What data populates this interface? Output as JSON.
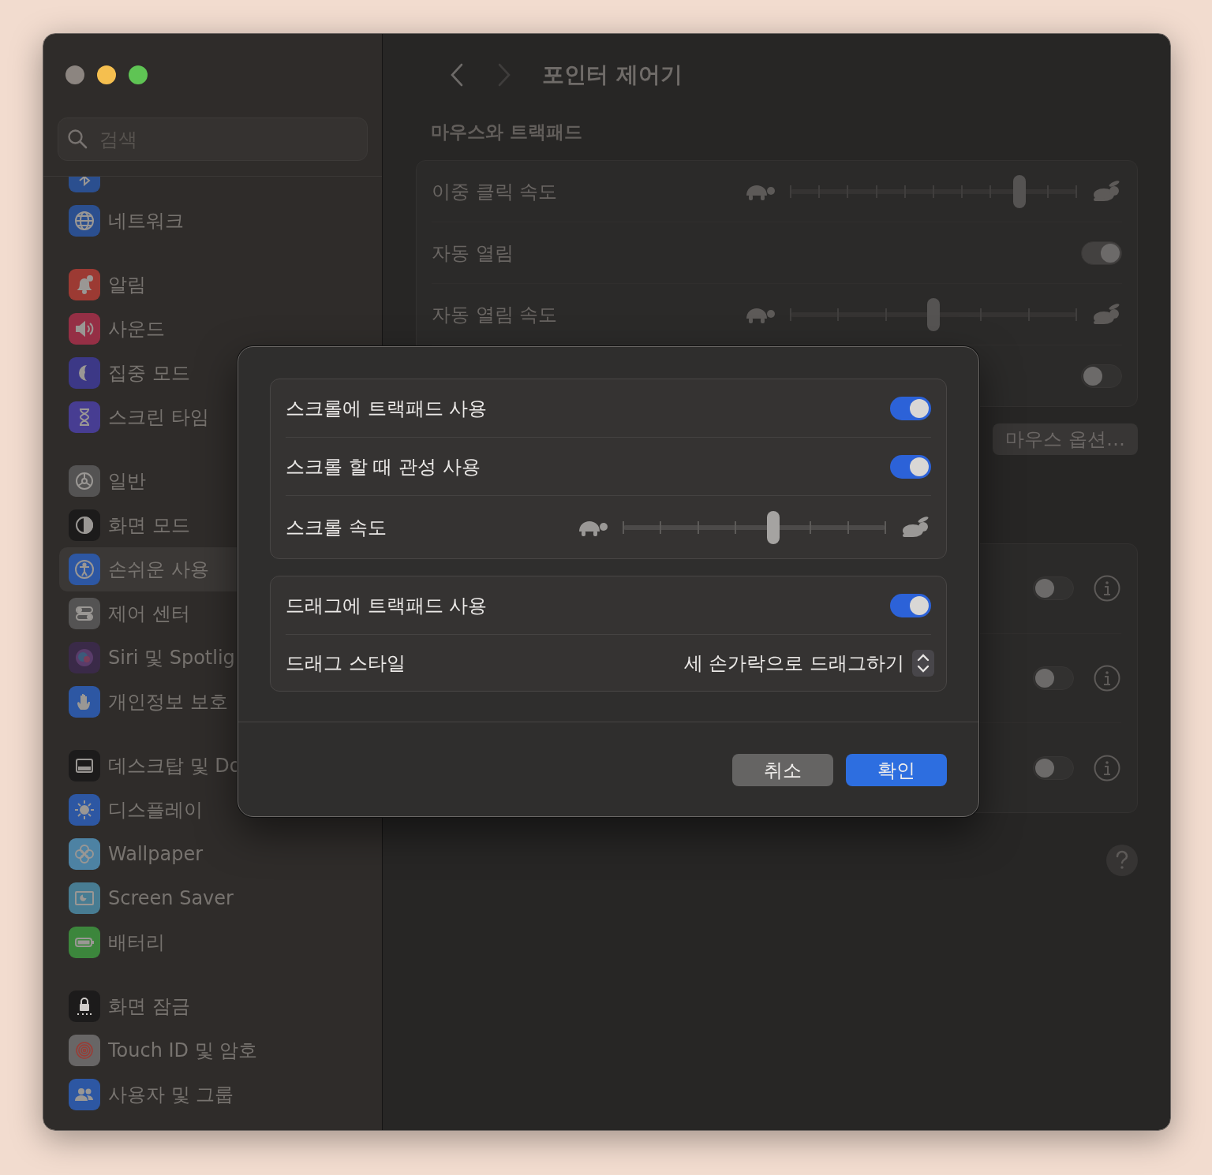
{
  "sidebar": {
    "search": {
      "placeholder": "검색"
    },
    "groups": [
      [
        {
          "color": "#2b4f8f",
          "selected": false
        },
        {
          "label": "네트워크",
          "color": "#2b4f8f",
          "selected": false
        }
      ],
      [
        {
          "label": "알림",
          "color": "#9c3a33",
          "selected": false
        },
        {
          "label": "사운드",
          "color": "#952f45",
          "selected": false
        },
        {
          "label": "집중 모드",
          "color": "#3c3886",
          "selected": false
        },
        {
          "label": "스크린 타임",
          "color": "#473d92",
          "selected": false
        }
      ],
      [
        {
          "label": "일반",
          "color": "#545353",
          "selected": false
        },
        {
          "label": "화면 모드",
          "color": "#1c1b1b",
          "selected": false
        },
        {
          "label": "손쉬운 사용",
          "color": "#2d57a3",
          "selected": true
        },
        {
          "label": "제어 센터",
          "color": "#545353",
          "selected": false
        },
        {
          "label": "Siri 및 Spotlig",
          "color": "#3a2a48",
          "selected": false
        },
        {
          "label": "개인정보 보호",
          "color": "#2d57a3",
          "selected": false
        }
      ],
      [
        {
          "label": "데스크탑 및 Do",
          "color": "#1c1b1b",
          "selected": false
        },
        {
          "label": "디스플레이",
          "color": "#2d57a3",
          "selected": false
        },
        {
          "label": "Wallpaper",
          "color": "#4d82a3",
          "selected": false
        },
        {
          "label": "Screen Saver",
          "color": "#487c92",
          "selected": false
        },
        {
          "label": "배터리",
          "color": "#3c863c",
          "selected": false
        }
      ],
      [
        {
          "label": "화면 잠금",
          "color": "#1c1b1b",
          "selected": false
        },
        {
          "label": "Touch ID 및 암호",
          "color": "#686666",
          "selected": false
        },
        {
          "label": "사용자 및 그룹",
          "color": "#2d57a3",
          "selected": false
        }
      ]
    ]
  },
  "main": {
    "title": "포인터 제어기",
    "section_title": "마우스와 트랙패드",
    "rows": [
      {
        "kind": "slider",
        "label": "이중 클릭 속도",
        "level": 0.8
      },
      {
        "kind": "toggle",
        "label": "자동 열림",
        "on": true
      },
      {
        "kind": "slider",
        "label": "자동 열림 속도",
        "level": 0.5
      },
      {
        "kind": "toggle",
        "on": false
      }
    ],
    "options_button": "마우스 옵션…",
    "more_rows": [
      {
        "on": false
      },
      {
        "on": false
      },
      {
        "on": false
      }
    ]
  },
  "dialog": {
    "groups": [
      [
        {
          "kind": "toggle",
          "label": "스크롤에 트랙패드 사용",
          "on": true
        },
        {
          "kind": "toggle",
          "label": "스크롤 할 때 관성 사용",
          "on": true
        },
        {
          "kind": "slider",
          "label": "스크롤 속도",
          "level": 0.571
        }
      ],
      [
        {
          "kind": "toggle",
          "label": "드래그에 트랙패드 사용",
          "on": true
        },
        {
          "kind": "popup",
          "label": "드래그 스타일",
          "value": "세 손가락으로 드래그하기"
        }
      ]
    ],
    "buttons": [
      {
        "kind": "secondary",
        "label": "취소"
      },
      {
        "kind": "primary",
        "label": "확인"
      }
    ]
  }
}
